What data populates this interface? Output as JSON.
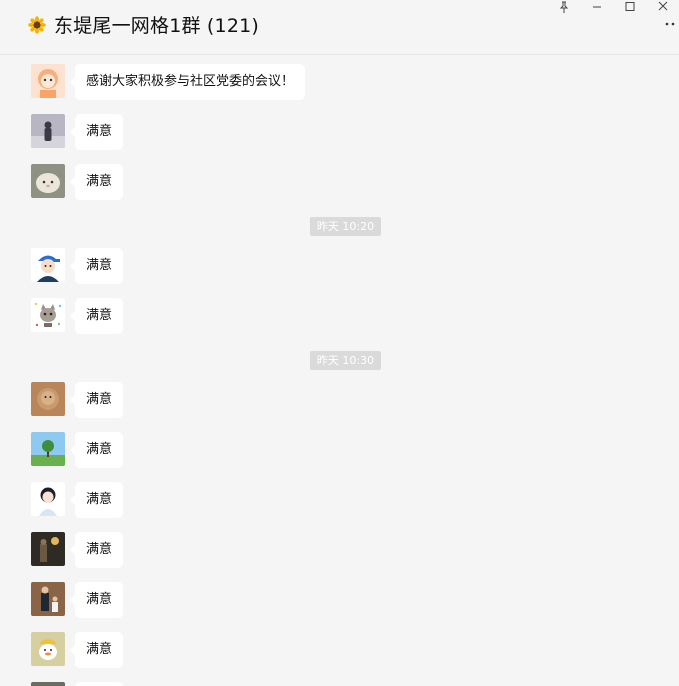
{
  "window": {
    "title": "东堤尾一网格1群 (121)",
    "title_icon": "sunflower-emoji",
    "controls": [
      "pin-icon",
      "minimize-icon",
      "maximize-icon",
      "close-icon",
      "more-icon"
    ]
  },
  "messages": [
    {
      "type": "msg",
      "avatar": "cartoon-character-avatar",
      "text": "感谢大家积极参与社区党委的会议！"
    },
    {
      "type": "msg",
      "avatar": "person-in-snow-avatar",
      "text": "满意"
    },
    {
      "type": "msg",
      "avatar": "plush-toy-avatar",
      "text": "满意"
    },
    {
      "type": "time",
      "text": "昨天 10:20"
    },
    {
      "type": "msg",
      "avatar": "cartoon-boy-cap-avatar",
      "text": "满意"
    },
    {
      "type": "msg",
      "avatar": "cartoon-cat-avatar",
      "text": "满意"
    },
    {
      "type": "time",
      "text": "昨天 10:30"
    },
    {
      "type": "msg",
      "avatar": "hamster-avatar",
      "text": "满意"
    },
    {
      "type": "msg",
      "avatar": "tree-landscape-avatar",
      "text": "满意"
    },
    {
      "type": "msg",
      "avatar": "anime-boy-avatar",
      "text": "满意"
    },
    {
      "type": "msg",
      "avatar": "night-photo-avatar",
      "text": "满意"
    },
    {
      "type": "msg",
      "avatar": "person-with-child-avatar",
      "text": "满意"
    },
    {
      "type": "msg",
      "avatar": "duck-cartoon-avatar",
      "text": "满意"
    }
  ],
  "colors": {
    "background": "#f5f5f5",
    "bubble": "#ffffff",
    "timestamp_bg": "#dadada"
  }
}
